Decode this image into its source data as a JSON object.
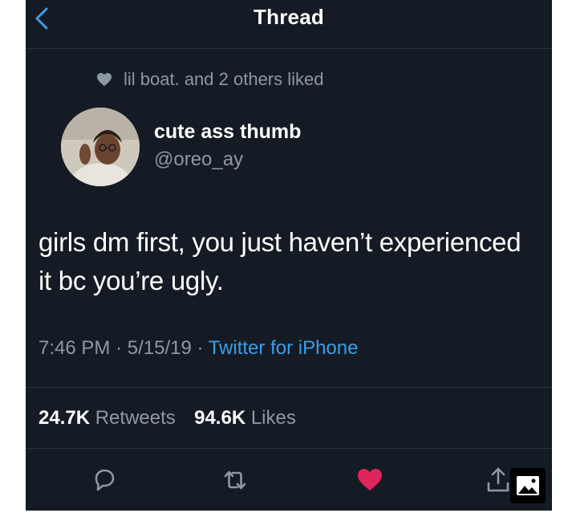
{
  "header": {
    "title": "Thread"
  },
  "social_context": {
    "text": "lil boat. and 2 others liked"
  },
  "author": {
    "display_name": "cute ass thumb",
    "handle": "@oreo_ay"
  },
  "tweet": {
    "text": "girls dm first, you just haven’t experienced it bc you’re ugly.",
    "time": "7:46 PM",
    "date": "5/15/19",
    "source": "Twitter for iPhone"
  },
  "stats": {
    "retweets_count": "24.7K",
    "retweets_label": "Retweets",
    "likes_count": "94.6K",
    "likes_label": "Likes"
  },
  "colors": {
    "background": "#151b24",
    "text": "#ffffff",
    "secondary": "#8d98a5",
    "link": "#3b9ee8",
    "like": "#e0245e"
  },
  "icons": [
    "back-chevron-icon",
    "heart-icon",
    "reply-icon",
    "retweet-icon",
    "like-heart-icon",
    "share-icon",
    "image-icon"
  ]
}
